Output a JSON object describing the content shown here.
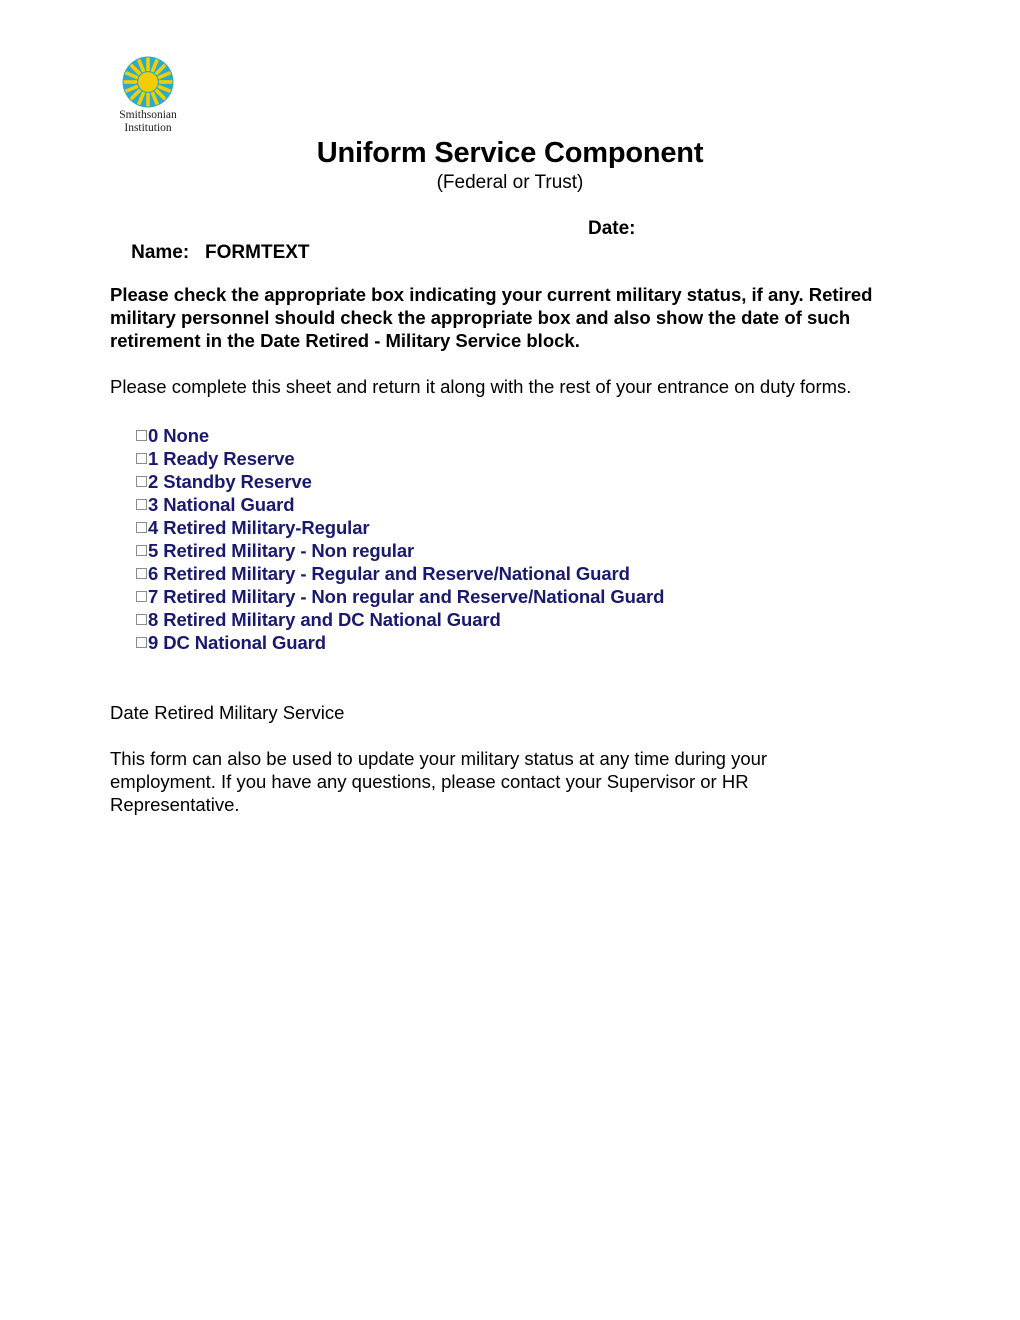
{
  "logo": {
    "icon": "smithsonian-sunburst-icon",
    "wordmark_line1": "Smithsonian",
    "wordmark_line2": "Institution",
    "circle_color": "#29ABCD",
    "sun_color": "#F2CD00"
  },
  "header": {
    "title": "Uniform Service Component",
    "subtitle": "(Federal or Trust)"
  },
  "name_date": {
    "name_label": "Name:",
    "name_value": "FORMTEXT",
    "date_label": "Date:"
  },
  "body": {
    "instructions": "Please check the appropriate box indicating your current military status, if any. Retired military personnel should check the appropriate box and also show the date of such retirement in the Date Retired - Military Service block.",
    "complete_note": "Please complete this sheet and return it along with the rest of your entrance on duty forms.",
    "date_retired_label": "Date Retired Military Service",
    "footer_note": "This form can also be used to update your military status at any time during your employment. If you have any questions, please contact your Supervisor or HR Representative."
  },
  "status_options": {
    "text_color": "#191970",
    "items": [
      {
        "code": "0",
        "label": "0 None",
        "checked": false
      },
      {
        "code": "1",
        "label": "1 Ready Reserve",
        "checked": false
      },
      {
        "code": "2",
        "label": "2 Standby Reserve",
        "checked": false
      },
      {
        "code": "3",
        "label": "3 National Guard",
        "checked": false
      },
      {
        "code": "4",
        "label": "4 Retired Military-Regular",
        "checked": false
      },
      {
        "code": "5",
        "label": "5 Retired Military - Non regular",
        "checked": false
      },
      {
        "code": "6",
        "label": "6 Retired Military - Regular and Reserve/National Guard",
        "checked": false
      },
      {
        "code": "7",
        "label": "7 Retired Military - Non regular and Reserve/National Guard",
        "checked": false
      },
      {
        "code": "8",
        "label": "8 Retired Military and DC National Guard",
        "checked": false
      },
      {
        "code": "9",
        "label": "9 DC National Guard",
        "checked": false
      }
    ]
  }
}
